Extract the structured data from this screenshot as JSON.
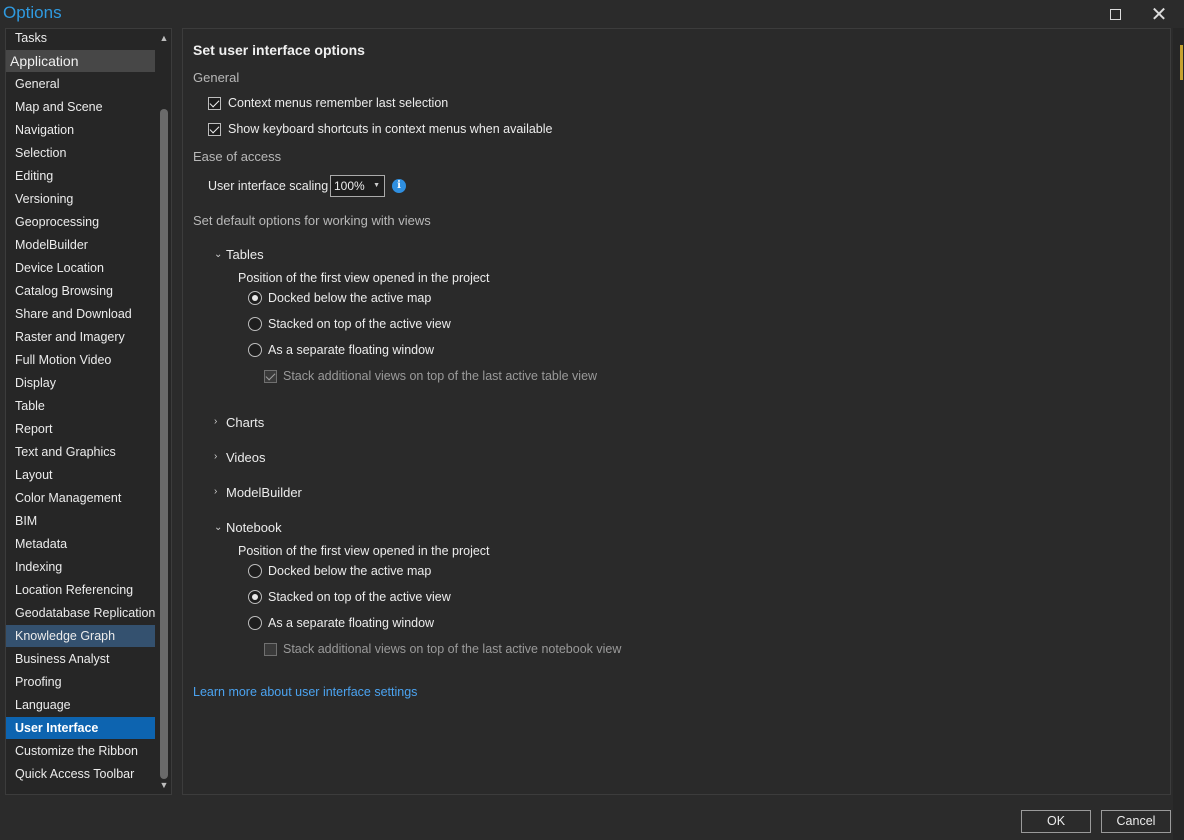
{
  "window": {
    "title": "Options"
  },
  "sidebar": {
    "items": [
      {
        "label": "Tasks",
        "type": "item"
      },
      {
        "label": "Application",
        "type": "header"
      },
      {
        "label": "General",
        "type": "item"
      },
      {
        "label": "Map and Scene",
        "type": "item"
      },
      {
        "label": "Navigation",
        "type": "item"
      },
      {
        "label": "Selection",
        "type": "item"
      },
      {
        "label": "Editing",
        "type": "item"
      },
      {
        "label": "Versioning",
        "type": "item"
      },
      {
        "label": "Geoprocessing",
        "type": "item"
      },
      {
        "label": "ModelBuilder",
        "type": "item"
      },
      {
        "label": "Device Location",
        "type": "item"
      },
      {
        "label": "Catalog Browsing",
        "type": "item"
      },
      {
        "label": "Share and Download",
        "type": "item"
      },
      {
        "label": "Raster and Imagery",
        "type": "item"
      },
      {
        "label": "Full Motion Video",
        "type": "item"
      },
      {
        "label": "Display",
        "type": "item"
      },
      {
        "label": "Table",
        "type": "item"
      },
      {
        "label": "Report",
        "type": "item"
      },
      {
        "label": "Text and Graphics",
        "type": "item"
      },
      {
        "label": "Layout",
        "type": "item"
      },
      {
        "label": "Color Management",
        "type": "item"
      },
      {
        "label": "BIM",
        "type": "item"
      },
      {
        "label": "Metadata",
        "type": "item"
      },
      {
        "label": "Indexing",
        "type": "item"
      },
      {
        "label": "Location Referencing",
        "type": "item"
      },
      {
        "label": "Geodatabase Replication",
        "type": "item"
      },
      {
        "label": "Knowledge Graph",
        "type": "hover"
      },
      {
        "label": "Business Analyst",
        "type": "item"
      },
      {
        "label": "Proofing",
        "type": "item"
      },
      {
        "label": "Language",
        "type": "item"
      },
      {
        "label": "User Interface",
        "type": "selected"
      },
      {
        "label": "Customize the Ribbon",
        "type": "item"
      },
      {
        "label": "Quick Access Toolbar",
        "type": "item"
      }
    ]
  },
  "main": {
    "title": "Set user interface options",
    "general": {
      "title": "General",
      "context_menus": {
        "label": "Context menus remember last selection",
        "checked": true
      },
      "keyboard_shortcuts": {
        "label": "Show keyboard shortcuts in context menus when available",
        "checked": true
      }
    },
    "ease_of_access": {
      "title": "Ease of access",
      "scaling_label": "User interface scaling",
      "scaling_value": "100%",
      "info_glyph": "i"
    },
    "views": {
      "title": "Set default options for working with views",
      "tables": {
        "label": "Tables",
        "expanded": true,
        "position_label": "Position of the first view opened in the project",
        "opt_docked": "Docked below the active map",
        "opt_stacked": "Stacked on top of the active view",
        "opt_floating": "As a separate floating window",
        "selected": "docked",
        "stack_label": "Stack additional views on top of the last active table view",
        "stack_checked": true
      },
      "charts": {
        "label": "Charts",
        "expanded": false
      },
      "videos": {
        "label": "Videos",
        "expanded": false
      },
      "modelbuilder": {
        "label": "ModelBuilder",
        "expanded": false
      },
      "notebook": {
        "label": "Notebook",
        "expanded": true,
        "position_label": "Position of the first view opened in the project",
        "opt_docked": "Docked below the active map",
        "opt_stacked": "Stacked on top of the active view",
        "opt_floating": "As a separate floating window",
        "selected": "stacked",
        "stack_label": "Stack additional views on top of the last active notebook view",
        "stack_checked": false
      }
    },
    "learn_more": "Learn more about user interface settings"
  },
  "buttons": {
    "ok": "OK",
    "cancel": "Cancel"
  },
  "icons": {
    "maximize": "maximize-icon",
    "close": "close-icon",
    "info": "info-icon",
    "chevron_down": "chevron-down-icon",
    "chevron_right": "chevron-right-icon"
  },
  "colors": {
    "accent": "#2f9ae0",
    "selected_bg": "#0d64b0",
    "hover_bg": "#34516f",
    "link": "#4ba3f0",
    "background": "#2b2b2b"
  }
}
